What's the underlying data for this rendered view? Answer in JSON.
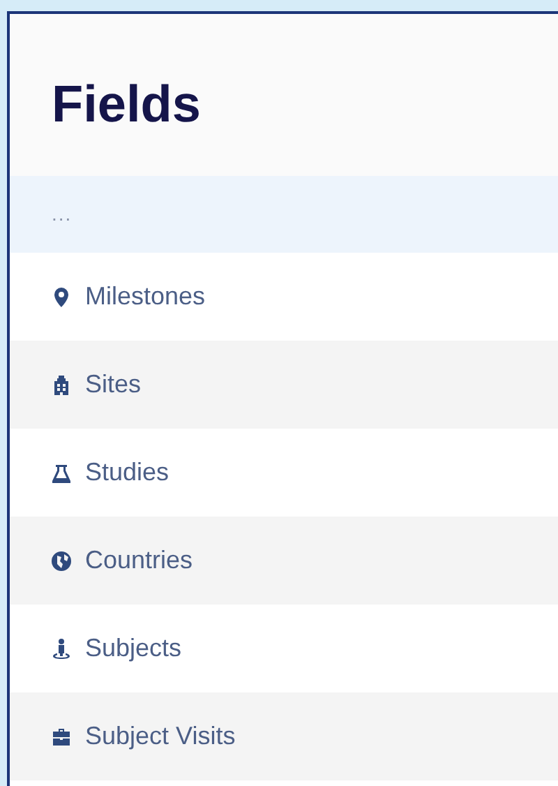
{
  "title": "Fields",
  "more": "...",
  "items": [
    {
      "label": "Milestones"
    },
    {
      "label": "Sites"
    },
    {
      "label": "Studies"
    },
    {
      "label": "Countries"
    },
    {
      "label": "Subjects"
    },
    {
      "label": "Subject Visits"
    }
  ]
}
